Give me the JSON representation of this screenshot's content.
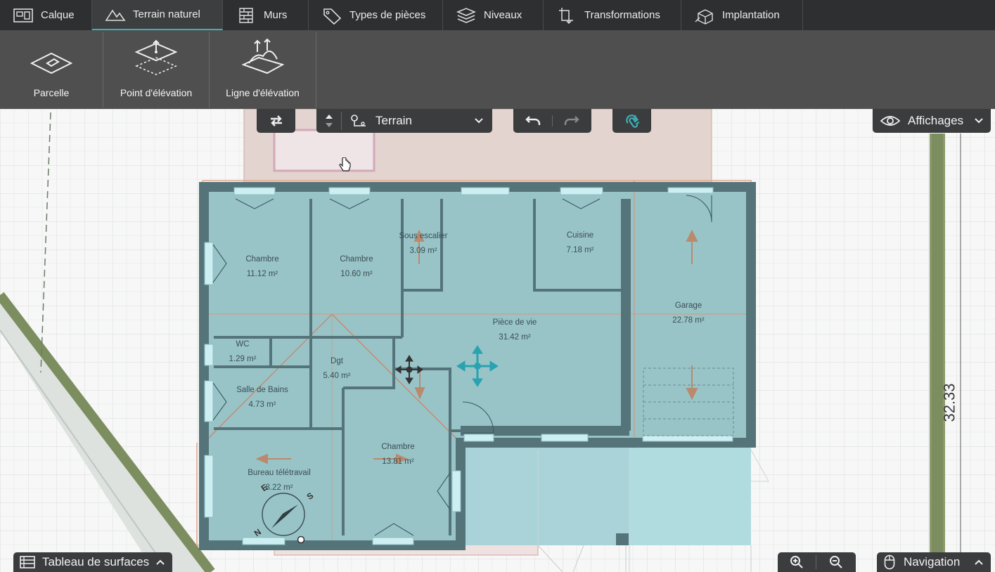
{
  "tabs": [
    {
      "label": "Calque",
      "icon": "layer-icon"
    },
    {
      "label": "Terrain naturel",
      "icon": "mountain-icon"
    },
    {
      "label": "Murs",
      "icon": "brick-wall-icon"
    },
    {
      "label": "Types de pièces",
      "icon": "tag-icon"
    },
    {
      "label": "Niveaux",
      "icon": "stack-levels-icon"
    },
    {
      "label": "Transformations",
      "icon": "transform-icon"
    },
    {
      "label": "Implantation",
      "icon": "implantation-icon"
    }
  ],
  "active_tab": "Terrain naturel",
  "ribbon": {
    "parcelle": "Parcelle",
    "point": "Point d'élévation",
    "ligne": "Ligne d'élévation"
  },
  "toolbar": {
    "level_select": "Terrain",
    "display_menu": "Affichages"
  },
  "rooms": [
    {
      "name": "Chambre",
      "area": "11.12 m²"
    },
    {
      "name": "Chambre",
      "area": "10.60 m²"
    },
    {
      "name": "Sous escalier",
      "area": "3.09 m²"
    },
    {
      "name": "Cuisine",
      "area": "7.18 m²"
    },
    {
      "name": "Garage",
      "area": "22.78 m²"
    },
    {
      "name": "Pièce de vie",
      "area": "31.42 m²"
    },
    {
      "name": "WC",
      "area": "1.29 m²"
    },
    {
      "name": "Dgt",
      "area": "5.40 m²"
    },
    {
      "name": "Salle de Bains",
      "area": "4.73 m²"
    },
    {
      "name": "Chambre",
      "area": "13.81 m²"
    },
    {
      "name": "Bureau télétravail",
      "area": "8.22 m²"
    }
  ],
  "dimension": "32.33",
  "compass": {
    "n": "N",
    "e": "E",
    "s": "S"
  },
  "bottom": {
    "surfaces": "Tableau de surfaces",
    "navigation": "Navigation"
  },
  "colors": {
    "accent": "#3cb0b8",
    "toolbar_bg": "#2e2f30",
    "ribbon_bg": "#4f4f4f",
    "room_fill": "#98c4c8",
    "wall": "#55757a",
    "terrain_pink": "#e2d2cd"
  }
}
